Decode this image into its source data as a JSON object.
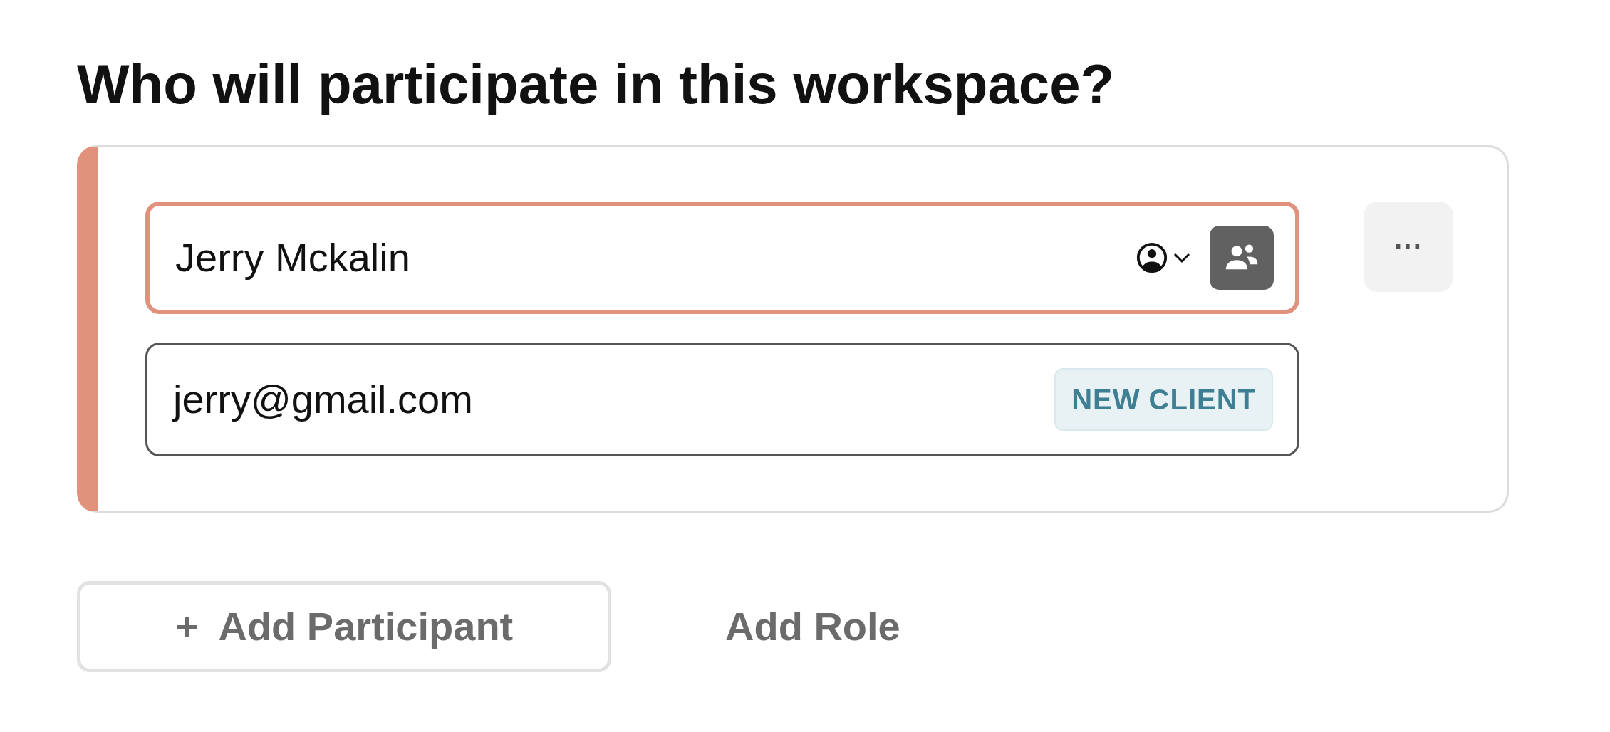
{
  "heading": "Who will participate in this workspace?",
  "participants": [
    {
      "name": "Jerry Mckalin",
      "email": "jerry@gmail.com",
      "badge": "NEW CLIENT",
      "more_label": "···"
    }
  ],
  "actions": [
    {
      "kind": "outlined",
      "icon": "+",
      "label": "Add Participant"
    },
    {
      "kind": "plain",
      "label": "Add Role"
    }
  ]
}
